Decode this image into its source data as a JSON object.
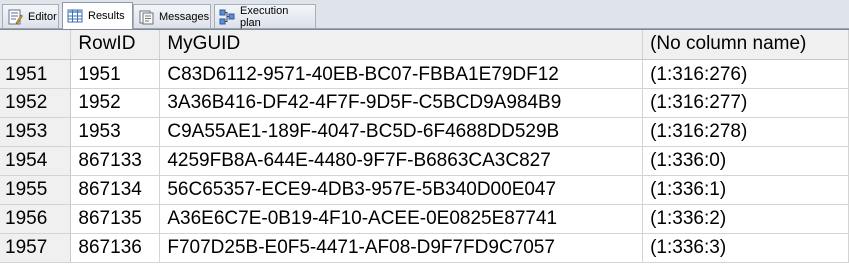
{
  "tabs": [
    {
      "label": "Editor",
      "icon": "editor-icon"
    },
    {
      "label": "Results",
      "icon": "grid-icon"
    },
    {
      "label": "Messages",
      "icon": "messages-icon"
    },
    {
      "label": "Execution plan",
      "icon": "execution-plan-icon"
    }
  ],
  "results": {
    "columns": [
      "",
      "RowID",
      "MyGUID",
      "(No column name)"
    ],
    "rows": [
      {
        "num": "1951",
        "rowid": "1951",
        "guid": "C83D6112-9571-40EB-BC07-FBBA1E79DF12",
        "loc": "(1:316:276)"
      },
      {
        "num": "1952",
        "rowid": "1952",
        "guid": "3A36B416-DF42-4F7F-9D5F-C5BCD9A984B9",
        "loc": "(1:316:277)"
      },
      {
        "num": "1953",
        "rowid": "1953",
        "guid": "C9A55AE1-189F-4047-BC5D-6F4688DD529B",
        "loc": "(1:316:278)"
      },
      {
        "num": "1954",
        "rowid": "867133",
        "guid": "4259FB8A-644E-4480-9F7F-B6863CA3C827",
        "loc": "(1:336:0)"
      },
      {
        "num": "1955",
        "rowid": "867134",
        "guid": "56C65357-ECE9-4DB3-957E-5B340D00E047",
        "loc": "(1:336:1)"
      },
      {
        "num": "1956",
        "rowid": "867135",
        "guid": "A36E6C7E-0B19-4F10-ACEE-0E0825E87741",
        "loc": "(1:336:2)"
      },
      {
        "num": "1957",
        "rowid": "867136",
        "guid": "F707D25B-E0F5-4471-AF08-D9F7FD9C7057",
        "loc": "(1:336:3)"
      }
    ]
  }
}
